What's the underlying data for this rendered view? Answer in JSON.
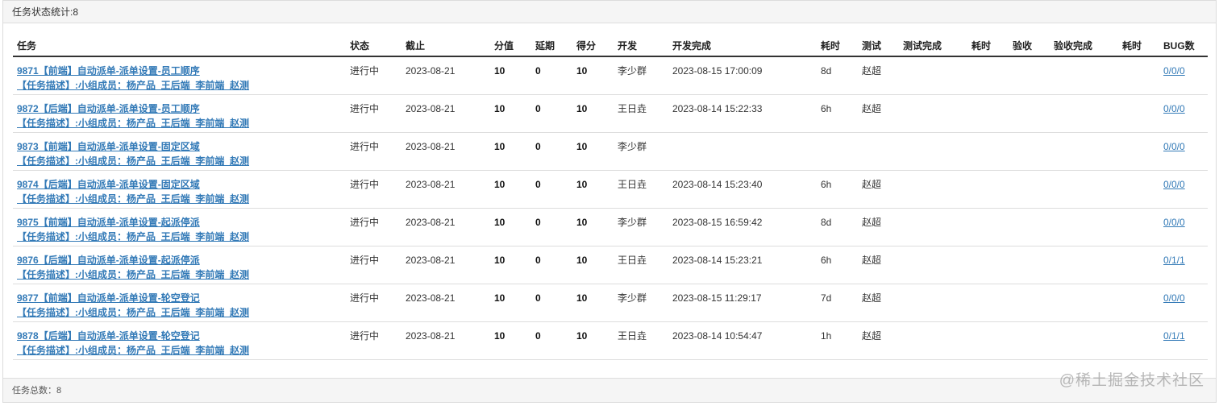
{
  "panel": {
    "heading": "任务状态统计:8",
    "footer": "任务总数：8"
  },
  "table": {
    "headers": [
      "任务",
      "状态",
      "截止",
      "分值",
      "延期",
      "得分",
      "开发",
      "开发完成",
      "耗时",
      "测试",
      "测试完成",
      "耗时",
      "验收",
      "验收完成",
      "耗时",
      "BUG数"
    ],
    "rows": [
      {
        "title": "9871【前端】自动派单-派单设置-员工顺序",
        "desc": "【任务描述】:小组成员：杨产品_王后端_李前端_赵测",
        "status": "进行中",
        "deadline": "2023-08-21",
        "score": "10",
        "delay": "0",
        "points": "10",
        "dev": "李少群",
        "dev_done": "2023-08-15 17:00:09",
        "dev_time": "8d",
        "tester": "赵超",
        "test_done": "",
        "test_time": "",
        "acceptor": "",
        "accept_done": "",
        "accept_time": "",
        "bugs": "0/0/0"
      },
      {
        "title": "9872【后端】自动派单-派单设置-员工顺序",
        "desc": "【任务描述】:小组成员：杨产品_王后端_李前端_赵测",
        "status": "进行中",
        "deadline": "2023-08-21",
        "score": "10",
        "delay": "0",
        "points": "10",
        "dev": "王日垚",
        "dev_done": "2023-08-14 15:22:33",
        "dev_time": "6h",
        "tester": "赵超",
        "test_done": "",
        "test_time": "",
        "acceptor": "",
        "accept_done": "",
        "accept_time": "",
        "bugs": "0/0/0"
      },
      {
        "title": "9873【前端】自动派单-派单设置-固定区域",
        "desc": "【任务描述】:小组成员：杨产品_王后端_李前端_赵测",
        "status": "进行中",
        "deadline": "2023-08-21",
        "score": "10",
        "delay": "0",
        "points": "10",
        "dev": "李少群",
        "dev_done": "",
        "dev_time": "",
        "tester": "",
        "test_done": "",
        "test_time": "",
        "acceptor": "",
        "accept_done": "",
        "accept_time": "",
        "bugs": "0/0/0"
      },
      {
        "title": "9874【后端】自动派单-派单设置-固定区域",
        "desc": "【任务描述】:小组成员：杨产品_王后端_李前端_赵测",
        "status": "进行中",
        "deadline": "2023-08-21",
        "score": "10",
        "delay": "0",
        "points": "10",
        "dev": "王日垚",
        "dev_done": "2023-08-14 15:23:40",
        "dev_time": "6h",
        "tester": "赵超",
        "test_done": "",
        "test_time": "",
        "acceptor": "",
        "accept_done": "",
        "accept_time": "",
        "bugs": "0/0/0"
      },
      {
        "title": "9875【前端】自动派单-派单设置-起派停派",
        "desc": "【任务描述】:小组成员：杨产品_王后端_李前端_赵测",
        "status": "进行中",
        "deadline": "2023-08-21",
        "score": "10",
        "delay": "0",
        "points": "10",
        "dev": "李少群",
        "dev_done": "2023-08-15 16:59:42",
        "dev_time": "8d",
        "tester": "赵超",
        "test_done": "",
        "test_time": "",
        "acceptor": "",
        "accept_done": "",
        "accept_time": "",
        "bugs": "0/0/0"
      },
      {
        "title": "9876【后端】自动派单-派单设置-起派停派",
        "desc": "【任务描述】:小组成员：杨产品_王后端_李前端_赵测",
        "status": "进行中",
        "deadline": "2023-08-21",
        "score": "10",
        "delay": "0",
        "points": "10",
        "dev": "王日垚",
        "dev_done": "2023-08-14 15:23:21",
        "dev_time": "6h",
        "tester": "赵超",
        "test_done": "",
        "test_time": "",
        "acceptor": "",
        "accept_done": "",
        "accept_time": "",
        "bugs": "0/1/1"
      },
      {
        "title": "9877【前端】自动派单-派单设置-轮空登记",
        "desc": "【任务描述】:小组成员：杨产品_王后端_李前端_赵测",
        "status": "进行中",
        "deadline": "2023-08-21",
        "score": "10",
        "delay": "0",
        "points": "10",
        "dev": "李少群",
        "dev_done": "2023-08-15 11:29:17",
        "dev_time": "7d",
        "tester": "赵超",
        "test_done": "",
        "test_time": "",
        "acceptor": "",
        "accept_done": "",
        "accept_time": "",
        "bugs": "0/0/0"
      },
      {
        "title": "9878【后端】自动派单-派单设置-轮空登记",
        "desc": "【任务描述】:小组成员：杨产品_王后端_李前端_赵测",
        "status": "进行中",
        "deadline": "2023-08-21",
        "score": "10",
        "delay": "0",
        "points": "10",
        "dev": "王日垚",
        "dev_done": "2023-08-14 10:54:47",
        "dev_time": "1h",
        "tester": "赵超",
        "test_done": "",
        "test_time": "",
        "acceptor": "",
        "accept_done": "",
        "accept_time": "",
        "bugs": "0/1/1"
      }
    ]
  },
  "watermark": "@稀土掘金技术社区",
  "colors": {
    "link": "#337ab7",
    "heading_bg": "#f5f5f5",
    "border": "#dddddd"
  }
}
